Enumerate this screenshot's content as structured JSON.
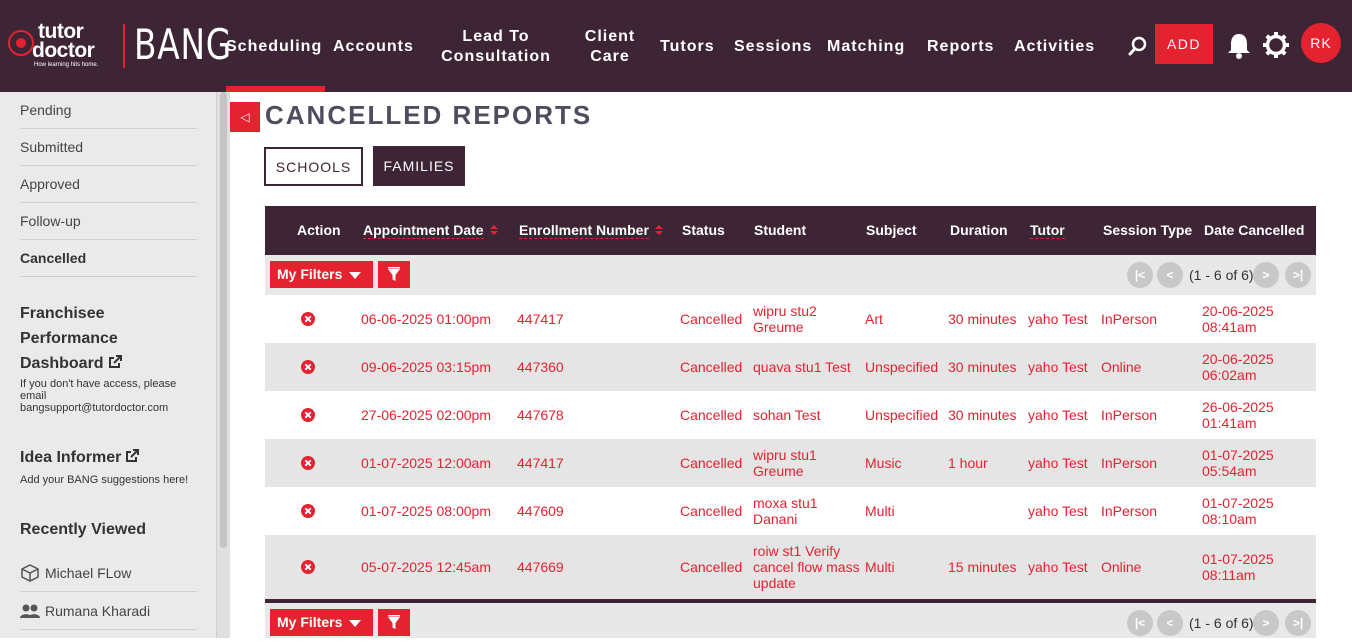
{
  "brand": {
    "logo_line1": "tutor",
    "logo_line2": "doctor",
    "logo_tagline": "How learning hits home.",
    "app_name": "BANG"
  },
  "nav": {
    "items": [
      {
        "label": "Scheduling",
        "active": true
      },
      {
        "label": "Accounts"
      },
      {
        "label": "Lead To\nConsultation"
      },
      {
        "label": "Client\nCare"
      },
      {
        "label": "Tutors"
      },
      {
        "label": "Sessions"
      },
      {
        "label": "Matching"
      },
      {
        "label": "Reports"
      },
      {
        "label": "Activities"
      }
    ],
    "add_label": "ADD",
    "avatar_initials": "RK"
  },
  "sidebar": {
    "links": [
      "Pending",
      "Submitted",
      "Approved",
      "Follow-up",
      "Cancelled"
    ],
    "active": "Cancelled",
    "franchisee": {
      "title_line1": "Franchisee",
      "title_line2": "Performance",
      "title_line3": "Dashboard",
      "note_line1": "If you don't have access, please",
      "note_line2": "email",
      "note_line3": "bangsupport@tutordoctor.com"
    },
    "idea": {
      "title": "Idea Informer",
      "note": "Add your BANG suggestions here!"
    },
    "recent": {
      "title": "Recently Viewed",
      "items": [
        {
          "label": "Michael FLow",
          "icon": "cube-icon"
        },
        {
          "label": "Rumana Kharadi",
          "icon": "people-icon"
        }
      ]
    }
  },
  "main": {
    "title": "CANCELLED REPORTS",
    "tabs": {
      "schools": "SCHOOLS",
      "families": "FAMILIES"
    },
    "columns": {
      "action": "Action",
      "appointment_date": "Appointment Date",
      "enrollment_number": "Enrollment Number",
      "status": "Status",
      "student": "Student",
      "subject": "Subject",
      "duration": "Duration",
      "tutor": "Tutor",
      "session_type": "Session Type",
      "date_cancelled": "Date Cancelled"
    },
    "filters": {
      "my_filters_label": "My Filters",
      "pagination_text": "(1 - 6 of 6)",
      "first": "|<",
      "prev": "<",
      "next": ">",
      "last": ">|"
    },
    "rows": [
      {
        "date": "06-06-2025 01:00pm",
        "enroll": "447417",
        "status": "Cancelled",
        "student1": "wipru stu2",
        "student2": "Greume",
        "student3": "",
        "subject": "Art",
        "duration": "30 minutes",
        "tutor": "yaho Test",
        "session": "InPerson",
        "cancel1": "20-06-2025",
        "cancel2": "08:41am"
      },
      {
        "date": "09-06-2025 03:15pm",
        "enroll": "447360",
        "status": "Cancelled",
        "student1": "quava stu1 Test",
        "student2": "",
        "student3": "",
        "subject": "Unspecified",
        "duration": "30 minutes",
        "tutor": "yaho Test",
        "session": "Online",
        "cancel1": "20-06-2025",
        "cancel2": "06:02am"
      },
      {
        "date": "27-06-2025 02:00pm",
        "enroll": "447678",
        "status": "Cancelled",
        "student1": "sohan Test",
        "student2": "",
        "student3": "",
        "subject": "Unspecified",
        "duration": "30 minutes",
        "tutor": "yaho Test",
        "session": "InPerson",
        "cancel1": "26-06-2025",
        "cancel2": "01:41am"
      },
      {
        "date": "01-07-2025 12:00am",
        "enroll": "447417",
        "status": "Cancelled",
        "student1": "wipru stu1",
        "student2": "Greume",
        "student3": "",
        "subject": "Music",
        "duration": "1 hour",
        "tutor": "yaho Test",
        "session": "InPerson",
        "cancel1": "01-07-2025",
        "cancel2": "05:54am"
      },
      {
        "date": "01-07-2025 08:00pm",
        "enroll": "447609",
        "status": "Cancelled",
        "student1": "moxa stu1",
        "student2": "Danani",
        "student3": "",
        "subject": "Multi",
        "duration": "",
        "tutor": "yaho Test",
        "session": "InPerson",
        "cancel1": "01-07-2025",
        "cancel2": "08:10am"
      },
      {
        "date": "05-07-2025 12:45am",
        "enroll": "447669",
        "status": "Cancelled",
        "student1": "roiw st1 Verify",
        "student2": "cancel flow mass",
        "student3": "update",
        "subject": "Multi",
        "duration": "15 minutes",
        "tutor": "yaho Test",
        "session": "Online",
        "cancel1": "01-07-2025",
        "cancel2": "08:11am"
      }
    ]
  },
  "colors": {
    "brand_dark": "#3d2535",
    "accent": "#e5222f"
  }
}
